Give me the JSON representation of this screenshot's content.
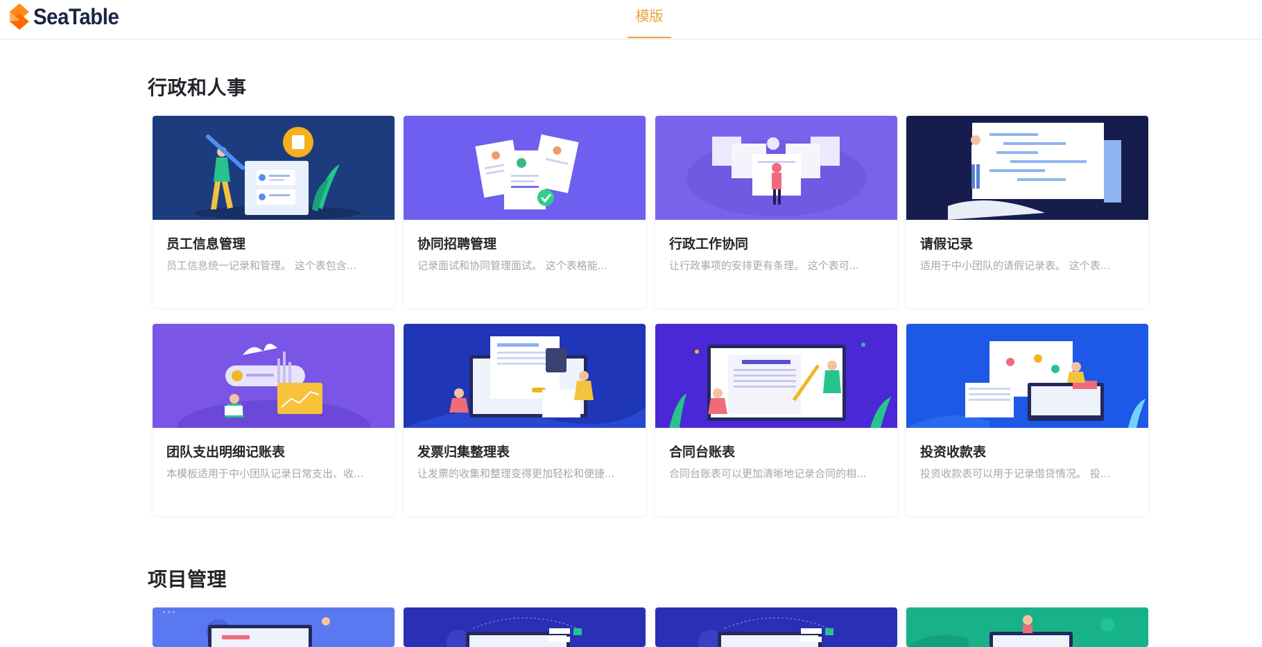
{
  "brand": {
    "name": "SeaTable"
  },
  "nav": {
    "active_tab": "模版"
  },
  "sections": [
    {
      "title": "行政和人事",
      "cards": [
        {
          "title": "员工信息管理",
          "desc": "员工信息统一记录和管理。 这个表包含...",
          "bg": "#1d3c7e"
        },
        {
          "title": "协同招聘管理",
          "desc": "记录面试和协同管理面试。 这个表格能...",
          "bg": "#6e5ff0"
        },
        {
          "title": "行政工作协同",
          "desc": "让行政事项的安排更有条理。 这个表可...",
          "bg": "#7b62ea"
        },
        {
          "title": "请假记录",
          "desc": "适用于中小团队的请假记录表。 这个表...",
          "bg": "#161d4d"
        },
        {
          "title": "团队支出明细记账表",
          "desc": "本模板适用于中小团队记录日常支出、收...",
          "bg": "#7a55e6"
        },
        {
          "title": "发票归集整理表",
          "desc": "让发票的收集和整理变得更加轻松和便捷...",
          "bg": "#1f36b8"
        },
        {
          "title": "合同台账表",
          "desc": "合同台账表可以更加清晰地记录合同的相...",
          "bg": "#4a28d6"
        },
        {
          "title": "投资收款表",
          "desc": "投资收款表可以用于记录借贷情况。 投...",
          "bg": "#1d58e6"
        }
      ]
    },
    {
      "title": "项目管理",
      "cards": [
        {
          "bg": "#5a78ef"
        },
        {
          "bg": "#2a30b5"
        },
        {
          "bg": "#2a30b5"
        },
        {
          "bg": "#18b28a"
        }
      ]
    }
  ]
}
